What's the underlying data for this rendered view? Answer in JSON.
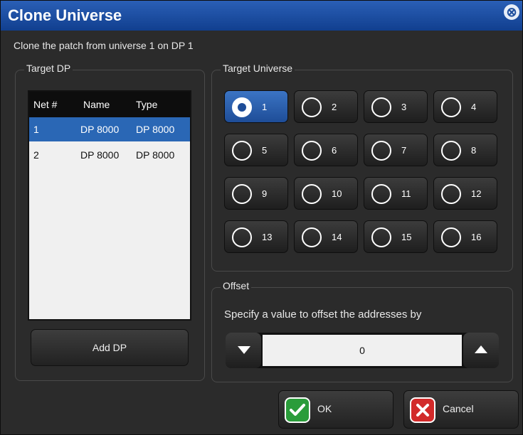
{
  "window": {
    "title": "Clone Universe",
    "close_icon": "close-icon"
  },
  "subtitle": "Clone the patch from universe 1 on DP 1",
  "target_dp": {
    "label": "Target DP",
    "columns": [
      "Net #",
      "Name",
      "Type"
    ],
    "rows": [
      {
        "net": "1",
        "name": "DP 8000",
        "type": "DP 8000",
        "selected": true
      },
      {
        "net": "2",
        "name": "DP 8000",
        "type": "DP 8000",
        "selected": false
      }
    ],
    "add_button": "Add DP"
  },
  "target_universe": {
    "label": "Target Universe",
    "selected": "1",
    "options": [
      "1",
      "2",
      "3",
      "4",
      "5",
      "6",
      "7",
      "8",
      "9",
      "10",
      "11",
      "12",
      "13",
      "14",
      "15",
      "16"
    ]
  },
  "offset": {
    "label": "Offset",
    "description": "Specify a value to offset the addresses by",
    "value": "0"
  },
  "buttons": {
    "ok": "OK",
    "cancel": "Cancel"
  },
  "colors": {
    "title_bar": "#1f4f9e",
    "selection": "#2a67b5",
    "ok_icon": "#2a9c3a",
    "cancel_icon": "#d22a2a"
  }
}
